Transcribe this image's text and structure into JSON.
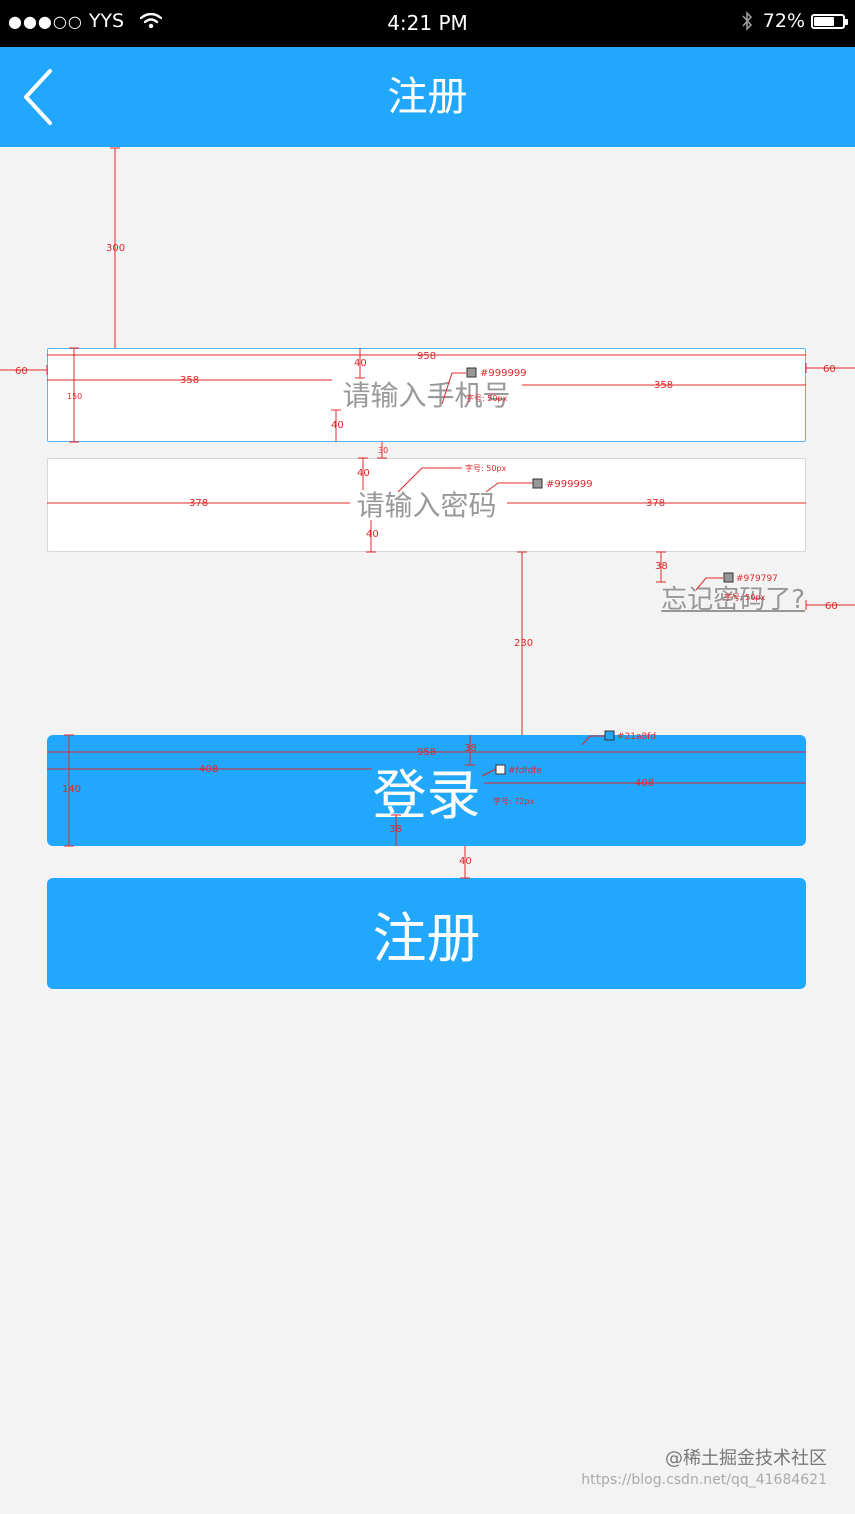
{
  "status_bar": {
    "signal": "●●●○○",
    "carrier": "YYS",
    "time": "4:21 PM",
    "battery": "72%",
    "battery_level": 0.72
  },
  "nav": {
    "title": "注册"
  },
  "form": {
    "phone_placeholder": "请输入手机号",
    "password_placeholder": "请输入密码",
    "forgot_label": "忘记密码了?",
    "login_label": "登录",
    "register_label": "注册"
  },
  "annotations": {
    "top_gap": "300",
    "outer_margin": "60",
    "field_width": "958",
    "phone_side": "358",
    "password_side": "378",
    "padding_40": "40",
    "field_height": "150",
    "field_gap": "30",
    "forgot_gap": "38",
    "button_gap": "230",
    "button_height": "140",
    "button_side": "408",
    "button_pad": "38",
    "register_gap": "40",
    "color_placeholder": "#999999",
    "color_forgot": "#979797",
    "color_brand": "#21a8fd",
    "color_text_white": "#fdfdfe",
    "font_50": "字号: 50px",
    "font_72": "字号: 72px"
  },
  "watermark": {
    "brand": "@稀土掘金技术社区",
    "url": "https://blog.csdn.net/qq_41684621"
  },
  "colors": {
    "brand": "#21a8fd",
    "background": "#f3f3f3",
    "annotation": "#e0282a"
  }
}
